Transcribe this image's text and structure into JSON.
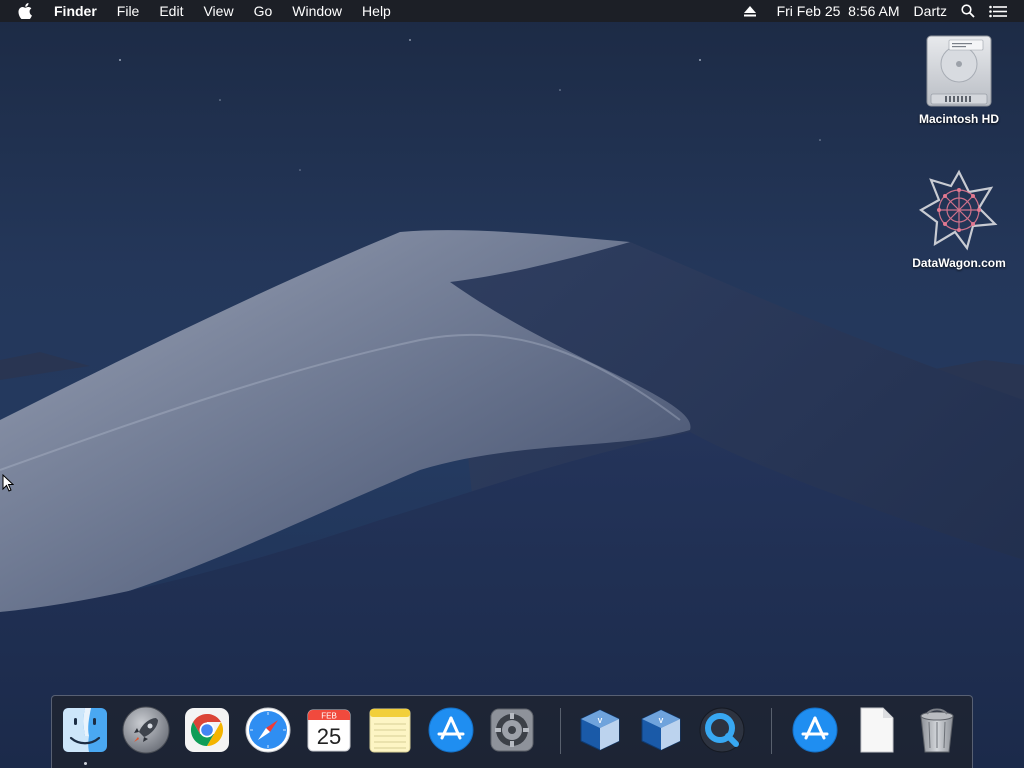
{
  "menubar": {
    "app_name": "Finder",
    "menus": [
      "File",
      "Edit",
      "View",
      "Go",
      "Window",
      "Help"
    ],
    "datetime": "Fri Feb 25  8:56 AM",
    "user": "Dartz",
    "icons": [
      "apple-icon",
      "eject-icon",
      "spotlight-search-icon",
      "notification-center-icon"
    ]
  },
  "desktop_icons": [
    {
      "label": "Macintosh HD",
      "icon": "hard-drive-icon"
    },
    {
      "label": "DataWagon.com",
      "icon": "datawagon-disk-icon"
    }
  ],
  "dock": {
    "items": [
      {
        "name": "finder",
        "icon": "finder-icon",
        "running": true
      },
      {
        "name": "launchpad",
        "icon": "launchpad-rocket-icon"
      },
      {
        "name": "chrome",
        "icon": "chrome-icon"
      },
      {
        "name": "safari",
        "icon": "safari-compass-icon"
      },
      {
        "name": "calendar",
        "icon": "calendar-icon",
        "month": "FEB",
        "day": "25"
      },
      {
        "name": "notes",
        "icon": "notes-icon"
      },
      {
        "name": "app-store",
        "icon": "app-store-icon"
      },
      {
        "name": "system-preferences",
        "icon": "gear-icon"
      },
      {
        "name": "virtualbox-1",
        "icon": "virtualbox-icon"
      },
      {
        "name": "virtualbox-2",
        "icon": "virtualbox-icon"
      },
      {
        "name": "quicktime",
        "icon": "quicktime-icon"
      },
      {
        "name": "app-store-downloads",
        "icon": "app-store-icon"
      },
      {
        "name": "document",
        "icon": "blank-document-icon"
      },
      {
        "name": "trash",
        "icon": "trash-icon"
      }
    ]
  },
  "colors": {
    "sky_top": "#1c2a44",
    "sky_bottom": "#243a60",
    "dune_light": "#8a93a8",
    "dune_dark": "#25324f"
  }
}
